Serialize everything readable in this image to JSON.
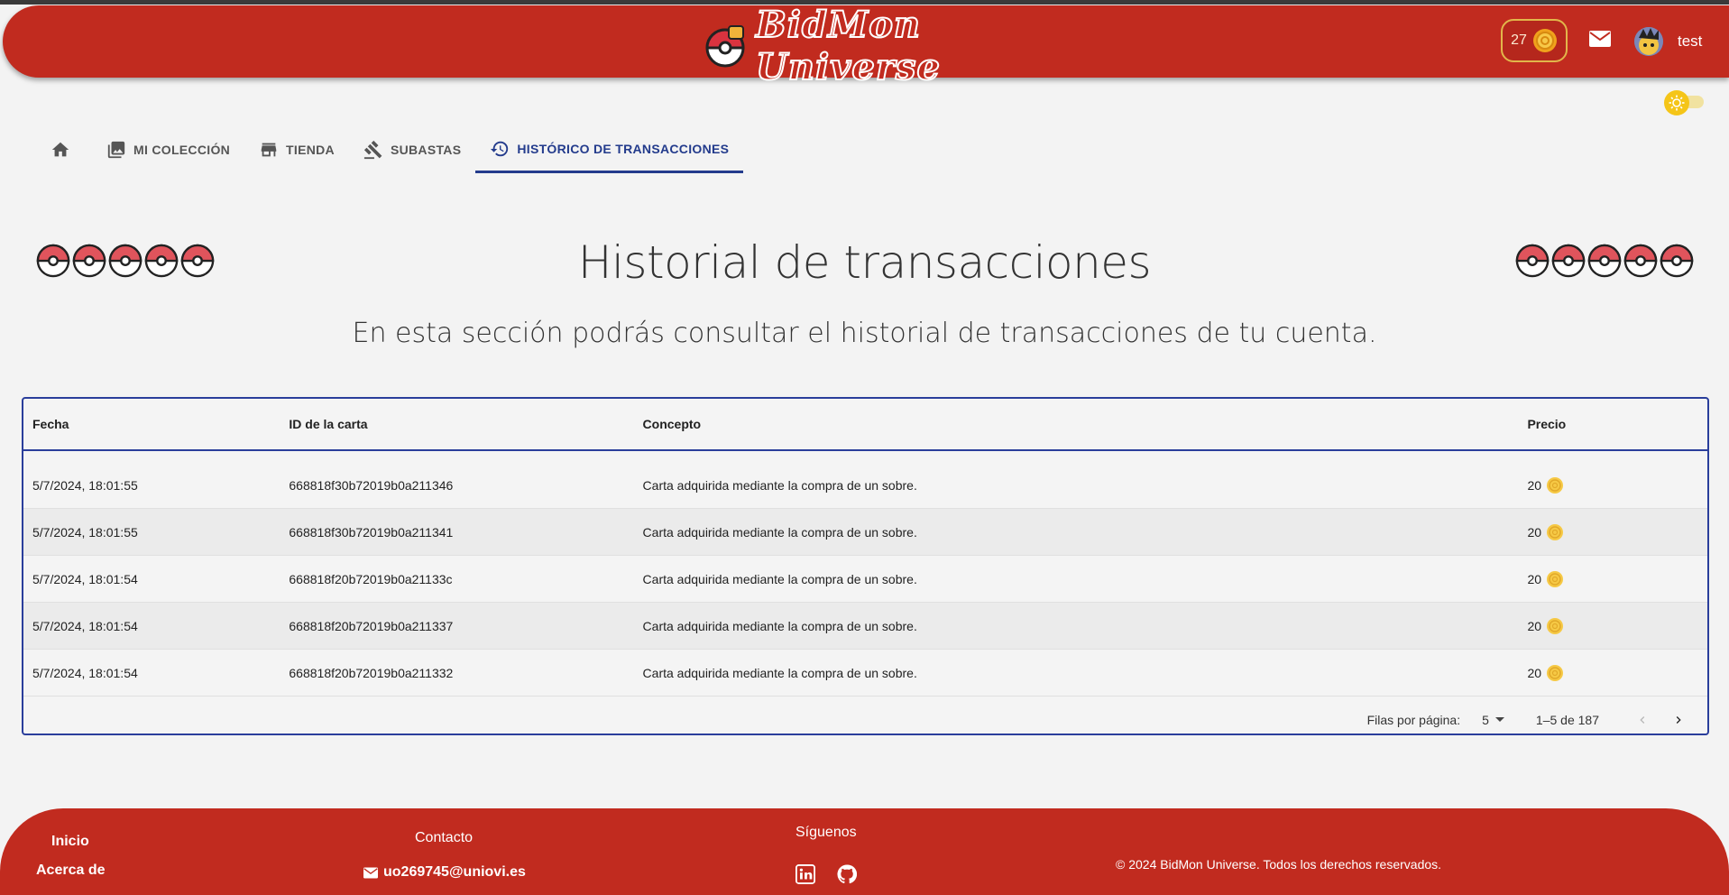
{
  "header": {
    "logo_text": "BidMon Universe",
    "coins": "27",
    "username": "test",
    "brand_color": "#c12b1f"
  },
  "tabs": [
    {
      "label": "",
      "icon": "home-icon"
    },
    {
      "label": "MI COLECCIÓN",
      "icon": "collection-icon"
    },
    {
      "label": "TIENDA",
      "icon": "store-icon"
    },
    {
      "label": "SUBASTAS",
      "icon": "gavel-icon"
    },
    {
      "label": "HISTÓRICO DE TRANSACCIONES",
      "icon": "history-icon",
      "active": true
    }
  ],
  "page": {
    "title": "Historial de transacciones",
    "subtitle": "En esta sección podrás consultar el historial de transacciones de tu cuenta."
  },
  "table": {
    "columns": [
      "Fecha",
      "ID de la carta",
      "Concepto",
      "Precio"
    ],
    "rows": [
      {
        "fecha": "5/7/2024, 18:01:55",
        "id": "668818f30b72019b0a211346",
        "concepto": "Carta adquirida mediante la compra de un sobre.",
        "precio": "20"
      },
      {
        "fecha": "5/7/2024, 18:01:55",
        "id": "668818f30b72019b0a211341",
        "concepto": "Carta adquirida mediante la compra de un sobre.",
        "precio": "20"
      },
      {
        "fecha": "5/7/2024, 18:01:54",
        "id": "668818f20b72019b0a21133c",
        "concepto": "Carta adquirida mediante la compra de un sobre.",
        "precio": "20"
      },
      {
        "fecha": "5/7/2024, 18:01:54",
        "id": "668818f20b72019b0a211337",
        "concepto": "Carta adquirida mediante la compra de un sobre.",
        "precio": "20"
      },
      {
        "fecha": "5/7/2024, 18:01:54",
        "id": "668818f20b72019b0a211332",
        "concepto": "Carta adquirida mediante la compra de un sobre.",
        "precio": "20"
      }
    ],
    "pagination": {
      "rows_per_page_label": "Filas por página:",
      "rows_per_page": "5",
      "range": "1–5 de 187"
    }
  },
  "footer": {
    "links": [
      "Inicio",
      "Acerca de"
    ],
    "contact_heading": "Contacto",
    "email": "uo269745@uniovi.es",
    "follow_heading": "Síguenos",
    "copyright": "© 2024 BidMon Universe. Todos los derechos reservados."
  }
}
